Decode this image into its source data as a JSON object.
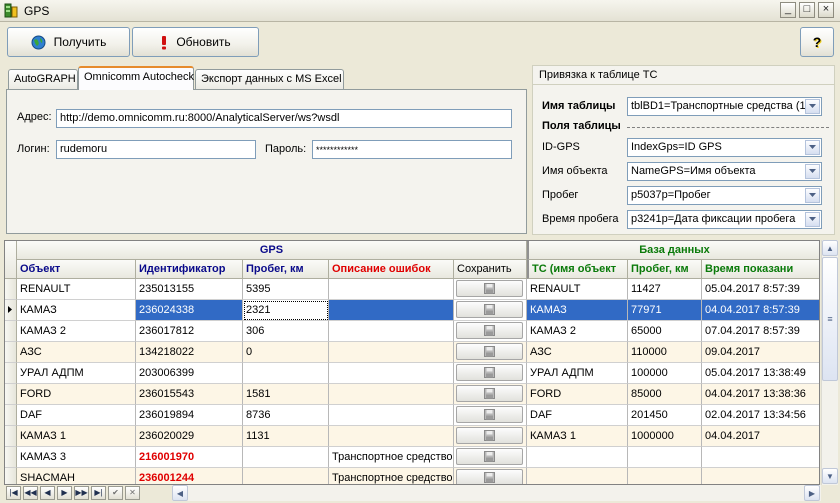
{
  "window": {
    "title": "GPS"
  },
  "toolbar": {
    "get_label": "Получить",
    "refresh_label": "Обновить",
    "help_label": "?"
  },
  "tabs": [
    {
      "label": "AutoGRAPH"
    },
    {
      "label": "Omnicomm Autocheck"
    },
    {
      "label": "Экспорт данных с MS Excel"
    }
  ],
  "connection": {
    "address_label": "Адрес:",
    "address_value": "http://demo.omnicomm.ru:8000/AnalyticalServer/ws?wsdl",
    "login_label": "Логин:",
    "login_value": "rudemoru",
    "password_label": "Пароль:",
    "password_value": "************"
  },
  "binding": {
    "title": "Привязка к таблице ТС",
    "table_name_label": "Имя таблицы",
    "table_name_value": "tblBD1=Транспортные средства (1",
    "fields_label": "Поля таблицы",
    "fields": [
      {
        "label": "ID-GPS",
        "value": "IndexGps=ID GPS"
      },
      {
        "label": "Имя объекта",
        "value": "NameGPS=Имя объекта"
      },
      {
        "label": "Пробег",
        "value": "p5037p=Пробег"
      },
      {
        "label": "Время пробега",
        "value": "p3241p=Дата фиксации пробега"
      }
    ]
  },
  "grid": {
    "gps_group": "GPS",
    "db_group": "База данных",
    "columns": [
      "Объект",
      "Идентификатор",
      "Пробег, км",
      "Описание ошибок",
      "Сохранить",
      "ТС (имя объект",
      "Пробег, км",
      "Время показани"
    ],
    "rows": [
      {
        "obj": "RENAULT",
        "id": "235013155",
        "km": "5395",
        "err": "",
        "ts": "RENAULT",
        "dbkm": "11427",
        "time": "05.04.2017 8:57:39",
        "id_error": false
      },
      {
        "obj": "КАМАЗ",
        "id": "236024338",
        "km": "2321",
        "err": "",
        "ts": "КАМАЗ",
        "dbkm": "77971",
        "time": "04.04.2017 8:57:39",
        "id_error": false
      },
      {
        "obj": "КАМАЗ 2",
        "id": "236017812",
        "km": "306",
        "err": "",
        "ts": "КАМАЗ 2",
        "dbkm": "65000",
        "time": "07.04.2017 8:57:39",
        "id_error": false
      },
      {
        "obj": "АЗС",
        "id": "134218022",
        "km": "0",
        "err": "",
        "ts": "АЗС",
        "dbkm": "110000",
        "time": "09.04.2017",
        "id_error": false
      },
      {
        "obj": "УРАЛ АДПМ",
        "id": "203006399",
        "km": "",
        "err": "",
        "ts": "УРАЛ АДПМ",
        "dbkm": "100000",
        "time": "05.04.2017 13:38:49",
        "id_error": false
      },
      {
        "obj": "FORD",
        "id": "236015543",
        "km": "1581",
        "err": "",
        "ts": "FORD",
        "dbkm": "85000",
        "time": "04.04.2017 13:38:36",
        "id_error": false
      },
      {
        "obj": "DAF",
        "id": "236019894",
        "km": "8736",
        "err": "",
        "ts": "DAF",
        "dbkm": "201450",
        "time": "02.04.2017 13:34:56",
        "id_error": false
      },
      {
        "obj": "КАМАЗ 1",
        "id": "236020029",
        "km": "1131",
        "err": "",
        "ts": "КАМАЗ 1",
        "dbkm": "1000000",
        "time": "04.04.2017",
        "id_error": false
      },
      {
        "obj": "КАМАЗ 3",
        "id": "216001970",
        "km": "",
        "err": "Транспортное средство",
        "ts": "",
        "dbkm": "",
        "time": "",
        "id_error": true
      },
      {
        "obj": "SHACMAH",
        "id": "236001244",
        "km": "",
        "err": "Транспортное средство",
        "ts": "",
        "dbkm": "",
        "time": "",
        "id_error": true
      }
    ],
    "selected_row": 1
  },
  "colors": {
    "selection": "#316ac5",
    "group_gps": "#0a0a8a",
    "group_db": "#0a7a0a",
    "error": "#e00000"
  },
  "icons": [
    "app-icon",
    "globe-icon",
    "exclamation-icon",
    "help-icon",
    "floppy-icon",
    "dropdown-arrow-icon"
  ]
}
